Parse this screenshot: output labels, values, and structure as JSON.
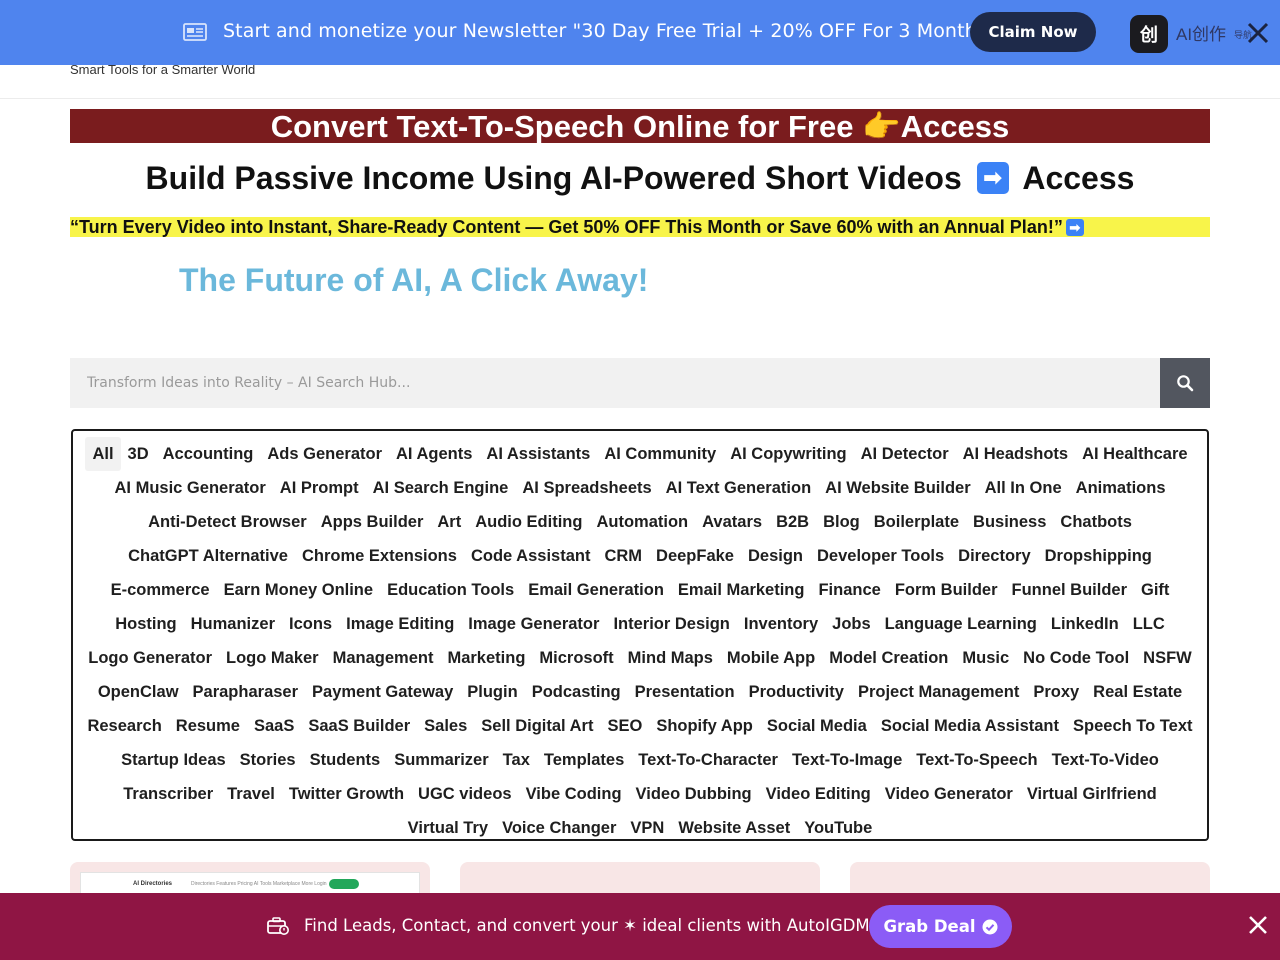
{
  "top_bar": {
    "text": "Start and monetize your Newsletter \"30 Day Free Trial + 20% OFF For 3 Months\"",
    "button": "Claim Now",
    "app_logo": "创",
    "app_name": "AI创作",
    "app_sub": "导航",
    "icons": [
      "newspaper-icon",
      "close-icon"
    ]
  },
  "header": {
    "tagline": "Smart Tools for a Smarter World"
  },
  "banner": {
    "text": "Convert Text-To-Speech Online for Free 👉Access"
  },
  "headline": {
    "text_before": "Build Passive Income Using AI-Powered Short Videos",
    "arrow": "➡",
    "text_after": "Access"
  },
  "promo_strip": {
    "text": "“Turn Every Video into Instant, Share-Ready Content — Get 50% OFF This Month or Save 60% with an Annual Plan!”",
    "arrow": "➡"
  },
  "tagline_big": "The Future of AI, A Click Away!",
  "search": {
    "placeholder": "Transform Ideas into Reality – AI Search Hub...",
    "value": ""
  },
  "categories": [
    "All",
    "3D",
    "Accounting",
    "Ads Generator",
    "AI Agents",
    "AI Assistants",
    "AI Community",
    "AI Copywriting",
    "AI Detector",
    "AI Headshots",
    "AI Healthcare",
    "AI Music Generator",
    "AI Prompt",
    "AI Search Engine",
    "AI Spreadsheets",
    "AI Text Generation",
    "AI Website Builder",
    "All In One",
    "Animations",
    "Anti-Detect Browser",
    "Apps Builder",
    "Art",
    "Audio Editing",
    "Automation",
    "Avatars",
    "B2B",
    "Blog",
    "Boilerplate",
    "Business",
    "Chatbots",
    "ChatGPT Alternative",
    "Chrome Extensions",
    "Code Assistant",
    "CRM",
    "DeepFake",
    "Design",
    "Developer Tools",
    "Directory",
    "Dropshipping",
    "E-commerce",
    "Earn Money Online",
    "Education Tools",
    "Email Generation",
    "Email Marketing",
    "Finance",
    "Form Builder",
    "Funnel Builder",
    "Gift",
    "Hosting",
    "Humanizer",
    "Icons",
    "Image Editing",
    "Image Generator",
    "Interior Design",
    "Inventory",
    "Jobs",
    "Language Learning",
    "LinkedIn",
    "LLC",
    "Logo Generator",
    "Logo Maker",
    "Management",
    "Marketing",
    "Microsoft",
    "Mind Maps",
    "Mobile App",
    "Model Creation",
    "Music",
    "No Code Tool",
    "NSFW",
    "OpenClaw",
    "Parapharaser",
    "Payment Gateway",
    "Plugin",
    "Podcasting",
    "Presentation",
    "Productivity",
    "Project Management",
    "Proxy",
    "Real Estate",
    "Research",
    "Resume",
    "SaaS",
    "SaaS Builder",
    "Sales",
    "Sell Digital Art",
    "SEO",
    "Shopify App",
    "Social Media",
    "Social Media Assistant",
    "Speech To Text",
    "Startup Ideas",
    "Stories",
    "Students",
    "Summarizer",
    "Tax",
    "Templates",
    "Text-To-Character",
    "Text-To-Image",
    "Text-To-Speech",
    "Text-To-Video",
    "Transcriber",
    "Travel",
    "Twitter Growth",
    "UGC videos",
    "Vibe Coding",
    "Video Dubbing",
    "Video Editing",
    "Video Generator",
    "Virtual Girlfriend",
    "Virtual Try",
    "Voice Changer",
    "VPN",
    "Website Asset",
    "YouTube"
  ],
  "active_category": "All",
  "card_preview": {
    "logo": "AI Directories",
    "nav": "Directories  Features  Pricing  AI Tools  Marketplace  More  Login"
  },
  "bottom_bar": {
    "text": "Find Leads, Contact, and convert your ✶ ideal clients with AutoIGDM ✶",
    "button": "Grab Deal",
    "icons": [
      "briefcase-icon",
      "check-circle-icon",
      "close-icon"
    ]
  },
  "colors": {
    "top_bar_bg": "#4f84ee",
    "claim_btn_bg": "#1e2a4a",
    "banner_red": "#7a1c1e",
    "yellow_strip": "#f8f44a",
    "future_text": "#6bb8db",
    "search_btn": "#52565f",
    "bottom_bar_bg": "#8f1544",
    "grab_btn_bg": "#8b5cf6",
    "card_bg": "#f8e6e6"
  }
}
